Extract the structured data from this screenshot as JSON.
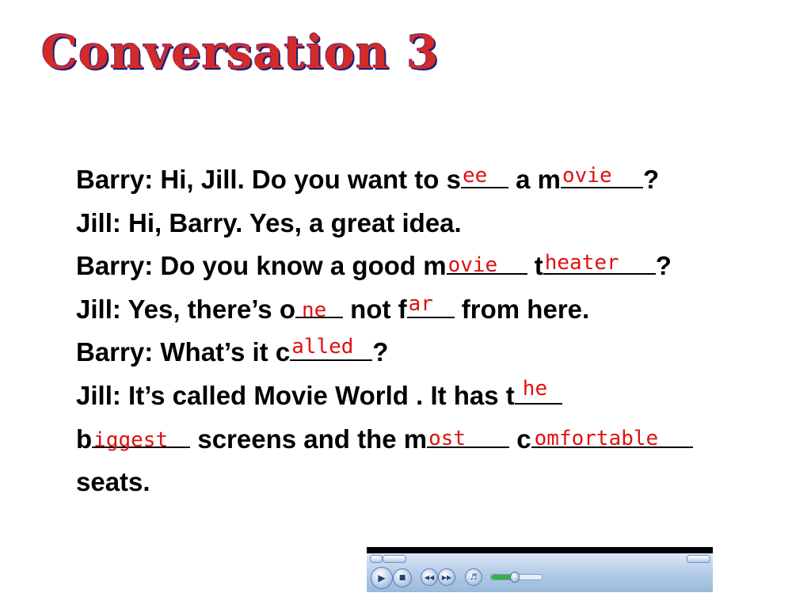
{
  "title": "Conversation 3",
  "lines": [
    {
      "speaker": "Barry:",
      "t1": "Hi, Jill. Do you want to s",
      "a1": "ee",
      "t2": " a m",
      "a2": "ovie",
      "t3": "?"
    },
    {
      "speaker": "Jill:",
      "t1": "Hi, Barry. Yes, a great idea."
    },
    {
      "speaker": "Barry:",
      "t1": "Do you know a good m",
      "a1": "ovie",
      "t2": " t",
      "a2": "heater",
      "t3": "?"
    },
    {
      "speaker": "Jill:",
      "t1": "Yes, there’s o",
      "a1": "ne",
      "t2": " not f",
      "a2": "ar",
      "t3": " from here."
    },
    {
      "speaker": "Barry:",
      "t1": "What’s it c",
      "a1": "alled",
      "t2": "?"
    },
    {
      "speaker": "Jill:",
      "t1": "It’s called Movie World . It has t",
      "a1": "he"
    },
    {
      "t1": "b",
      "a1": "iggest",
      "t2": " screens and the m",
      "a2": "ost",
      "t3": " c",
      "a3": "omfortable"
    },
    {
      "t1": "seats."
    }
  ],
  "player": {
    "play_icon": "play-icon",
    "stop_icon": "stop-icon",
    "prev_icon": "previous-icon",
    "next_icon": "next-icon",
    "volume_icon": "speaker-icon",
    "volume_level": 0.45
  },
  "colors": {
    "answer": "#e01010",
    "title_fill": "#d42a28",
    "title_shadow": "#1c1f7a"
  }
}
